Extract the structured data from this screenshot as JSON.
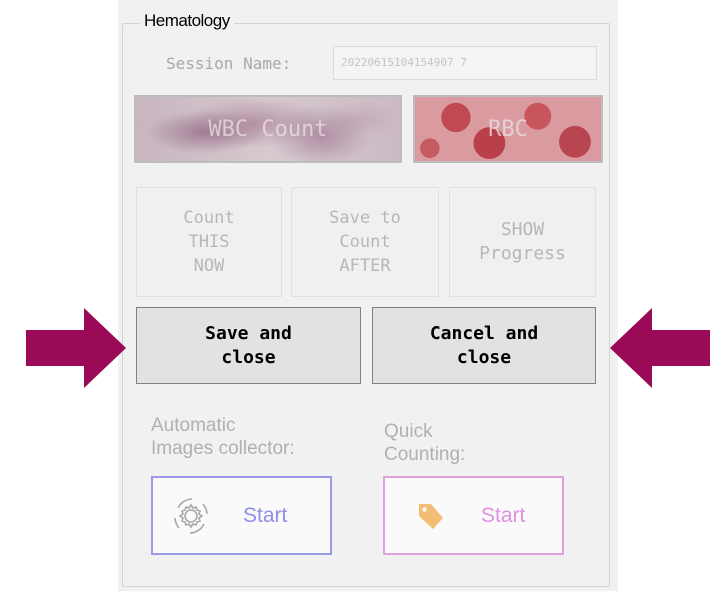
{
  "group": {
    "title": "Hematology"
  },
  "session": {
    "label": "Session Name:",
    "value": "20220615104154907 7"
  },
  "image_buttons": {
    "wbc_label": "WBC Count",
    "rbc_label": "RBC"
  },
  "actions": {
    "count_now": "Count\nTHIS\nNOW",
    "save_to_count": "Save to\nCount\nAFTER",
    "show_progress": "SHOW\nProgress"
  },
  "dialog": {
    "save_close": "Save and\nclose",
    "cancel_close": "Cancel and\nclose"
  },
  "auto_collector": {
    "label": "Automatic\nImages collector:",
    "start": "Start"
  },
  "quick_counting": {
    "label": "Quick\nCounting:",
    "start": "Start"
  },
  "colors": {
    "arrow": "#9b0a57",
    "collector_border": "#9a9ae8",
    "collector_text": "#8f8fe8",
    "quick_border": "#e0a0e0",
    "quick_text": "#e090e0"
  }
}
